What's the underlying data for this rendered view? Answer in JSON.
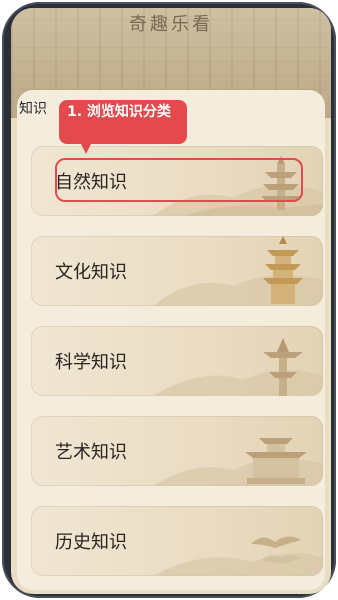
{
  "app": {
    "title": "奇趣乐看"
  },
  "section": {
    "title": "知识"
  },
  "categories": [
    {
      "label": "自然知识",
      "icon": "pagoda-icon"
    },
    {
      "label": "文化知识",
      "icon": "tower-icon"
    },
    {
      "label": "科学知识",
      "icon": "pavilion-icon"
    },
    {
      "label": "艺术知识",
      "icon": "temple-icon"
    },
    {
      "label": "历史知识",
      "icon": "bird-icon"
    }
  ],
  "annotation": {
    "text": "1. 浏览知识分类",
    "color": "#e44a4d"
  },
  "colors": {
    "background": "#e9ddc3",
    "card": "#eadcc2",
    "accent": "#e44a4d"
  }
}
